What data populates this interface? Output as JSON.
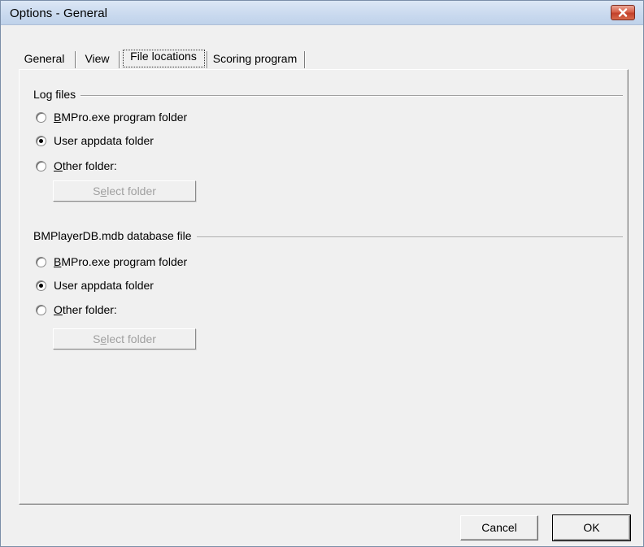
{
  "window": {
    "title": "Options - General",
    "close_icon": "close-icon"
  },
  "tabs": [
    {
      "label": "General",
      "active": false
    },
    {
      "label": "View",
      "active": false
    },
    {
      "label": "File locations",
      "active": true
    },
    {
      "label": "Scoring program",
      "active": false
    }
  ],
  "log_files": {
    "group_label": "Log files",
    "options": [
      {
        "prefix": "B",
        "rest": "MPro.exe program folder",
        "checked": false
      },
      {
        "prefix": "",
        "rest": "User appdata folder",
        "checked": true
      },
      {
        "prefix": "O",
        "rest": "ther folder:",
        "checked": false
      }
    ],
    "select_button": {
      "pre": "S",
      "accel": "e",
      "post": "lect folder",
      "enabled": false
    }
  },
  "database_file": {
    "group_label": "BMPlayerDB.mdb database file",
    "options": [
      {
        "prefix": "B",
        "rest": "MPro.exe program folder",
        "checked": false
      },
      {
        "prefix": "",
        "rest": "User appdata folder",
        "checked": true
      },
      {
        "prefix": "O",
        "rest": "ther folder:",
        "checked": false
      }
    ],
    "select_button": {
      "pre": "S",
      "accel": "e",
      "post": "lect folder",
      "enabled": false
    }
  },
  "footer": {
    "cancel_label": "Cancel",
    "ok_label": "OK"
  }
}
